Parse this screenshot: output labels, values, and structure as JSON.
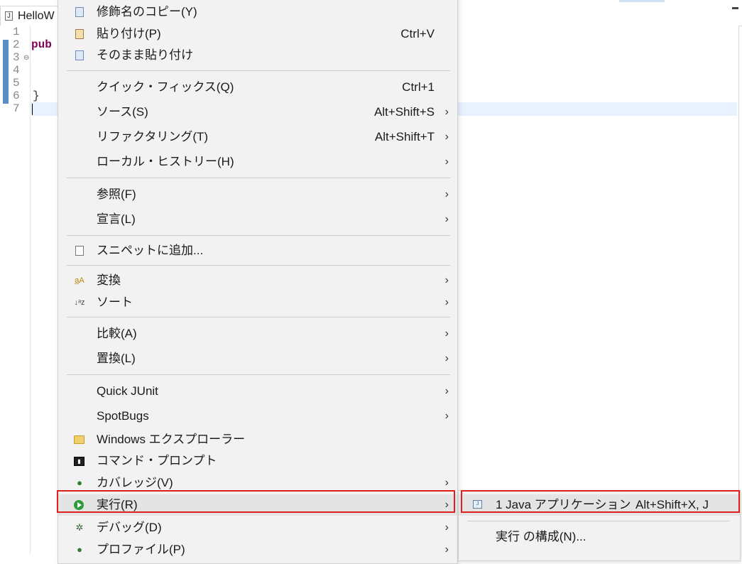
{
  "editor": {
    "tab_title": "HelloW",
    "line_numbers": [
      "1",
      "2",
      "3",
      "4",
      "5",
      "6",
      "7"
    ],
    "code_keyword": "pub",
    "closing_brace": "}"
  },
  "context_menu": {
    "items": [
      {
        "label": "修飾名のコピー(Y)",
        "shortcut": "",
        "icon": "copy-icon",
        "submenu": false
      },
      {
        "label": "貼り付け(P)",
        "shortcut": "Ctrl+V",
        "icon": "paste-icon",
        "submenu": false
      },
      {
        "label": "そのまま貼り付け",
        "shortcut": "",
        "icon": "copy-icon",
        "submenu": false
      },
      {
        "label": "クイック・フィックス(Q)",
        "shortcut": "Ctrl+1",
        "icon": "",
        "submenu": false
      },
      {
        "label": "ソース(S)",
        "shortcut": "Alt+Shift+S",
        "icon": "",
        "submenu": true
      },
      {
        "label": "リファクタリング(T)",
        "shortcut": "Alt+Shift+T",
        "icon": "",
        "submenu": true
      },
      {
        "label": "ローカル・ヒストリー(H)",
        "shortcut": "",
        "icon": "",
        "submenu": true
      },
      {
        "label": "参照(F)",
        "shortcut": "",
        "icon": "",
        "submenu": true
      },
      {
        "label": "宣言(L)",
        "shortcut": "",
        "icon": "",
        "submenu": true
      },
      {
        "label": "スニペットに追加...",
        "shortcut": "",
        "icon": "snippet-icon",
        "submenu": false
      },
      {
        "label": "変換",
        "shortcut": "",
        "icon": "convert-icon",
        "submenu": true
      },
      {
        "label": "ソート",
        "shortcut": "",
        "icon": "sort-icon",
        "submenu": true
      },
      {
        "label": "比較(A)",
        "shortcut": "",
        "icon": "",
        "submenu": true
      },
      {
        "label": "置換(L)",
        "shortcut": "",
        "icon": "",
        "submenu": true
      },
      {
        "label": "Quick JUnit",
        "shortcut": "",
        "icon": "",
        "submenu": true
      },
      {
        "label": "SpotBugs",
        "shortcut": "",
        "icon": "",
        "submenu": true
      },
      {
        "label": "Windows エクスプローラー",
        "shortcut": "",
        "icon": "folder-icon",
        "submenu": false
      },
      {
        "label": "コマンド・プロンプト",
        "shortcut": "",
        "icon": "terminal-icon",
        "submenu": false
      },
      {
        "label": "カバレッジ(V)",
        "shortcut": "",
        "icon": "coverage-icon",
        "submenu": true
      },
      {
        "label": "実行(R)",
        "shortcut": "",
        "icon": "run-icon",
        "submenu": true
      },
      {
        "label": "デバッグ(D)",
        "shortcut": "",
        "icon": "debug-icon",
        "submenu": true
      },
      {
        "label": "プロファイル(P)",
        "shortcut": "",
        "icon": "profile-icon",
        "submenu": true
      }
    ]
  },
  "run_submenu": {
    "items": [
      {
        "label": "1 Java アプリケーション",
        "shortcut": "Alt+Shift+X, J",
        "icon": "java-app-icon"
      },
      {
        "label": "実行 の構成(N)...",
        "shortcut": "",
        "icon": ""
      }
    ]
  },
  "colors": {
    "highlight_border": "#e0201e",
    "menu_background": "#f2f2f2",
    "keyword": "#7f0055",
    "ruler_mark": "#5b8fc4"
  }
}
